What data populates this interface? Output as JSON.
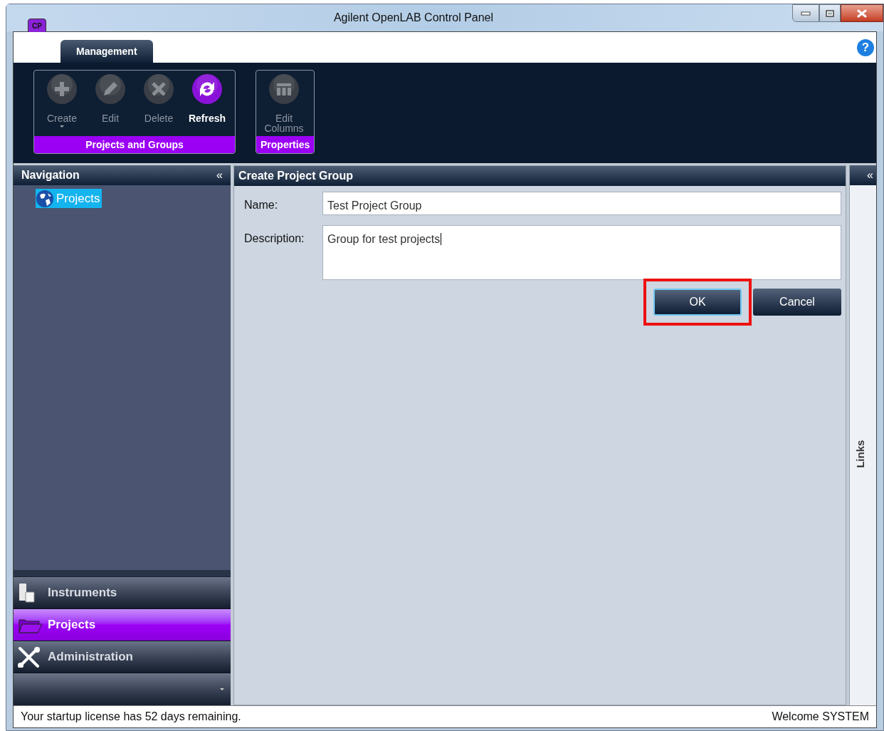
{
  "window": {
    "title": "Agilent OpenLAB Control Panel",
    "app_icon_text": "CP",
    "help": "?"
  },
  "ribbon_tabs": [
    {
      "label": "Management",
      "selected": true
    }
  ],
  "ribbon_groups": [
    {
      "title": "Projects and Groups",
      "buttons": [
        {
          "label": "Create",
          "kind": "plus",
          "disabled": true,
          "dropdown": true
        },
        {
          "label": "Edit",
          "kind": "pencil",
          "disabled": true,
          "dropdown": false
        },
        {
          "label": "Delete",
          "kind": "cross",
          "disabled": true,
          "dropdown": false
        },
        {
          "label": "Refresh",
          "kind": "refresh",
          "disabled": false,
          "dropdown": false
        }
      ]
    },
    {
      "title": "Properties",
      "buttons": [
        {
          "label": "Edit Columns",
          "kind": "columns",
          "disabled": true,
          "dropdown": false
        }
      ]
    }
  ],
  "navigation": {
    "title": "Navigation",
    "collapse": "«",
    "tree": [
      {
        "label": "Projects",
        "selected": true
      }
    ],
    "sections": [
      {
        "label": "Instruments",
        "kind": "instruments",
        "selected": false
      },
      {
        "label": "Projects",
        "kind": "folder",
        "selected": true
      },
      {
        "label": "Administration",
        "kind": "tools",
        "selected": false
      }
    ]
  },
  "form": {
    "title": "Create Project Group",
    "fields": [
      {
        "label": "Name:",
        "value": "Test Project Group",
        "kind": "line"
      },
      {
        "label": "Description:",
        "value": "Group for test projects",
        "kind": "area"
      }
    ],
    "buttons": [
      {
        "label": "OK",
        "highlighted": true
      },
      {
        "label": "Cancel",
        "highlighted": false
      }
    ]
  },
  "links_panel": {
    "title": "Links",
    "collapse": "«"
  },
  "status_bar": {
    "message": "Your startup license has 52 days remaining.",
    "user": "Welcome SYSTEM"
  }
}
